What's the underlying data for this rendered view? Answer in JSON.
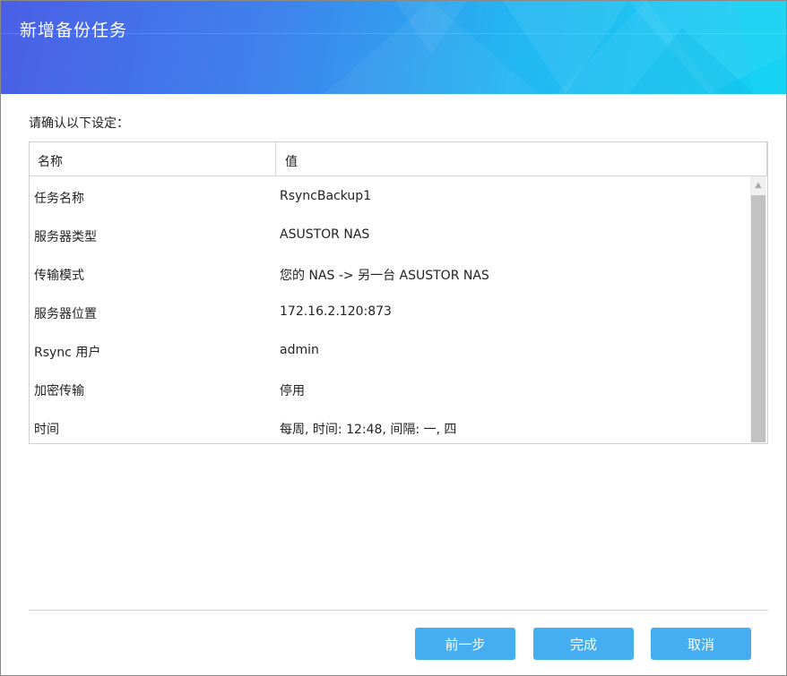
{
  "dialog": {
    "title": "新增备份任务",
    "prompt": "请确认以下设定："
  },
  "table": {
    "headers": {
      "name": "名称",
      "value": "值"
    },
    "rows": [
      {
        "name": "任务名称",
        "value": "RsyncBackup1"
      },
      {
        "name": "服务器类型",
        "value": "ASUSTOR NAS"
      },
      {
        "name": "传输模式",
        "value": "您的 NAS -> 另一台 ASUSTOR NAS"
      },
      {
        "name": "服务器位置",
        "value": "172.16.2.120:873"
      },
      {
        "name": "Rsync 用户",
        "value": "admin"
      },
      {
        "name": "加密传输",
        "value": "停用"
      },
      {
        "name": "时间",
        "value": "每周, 时间: 12:48, 间隔: 一, 四"
      }
    ]
  },
  "buttons": {
    "prev": "前一步",
    "finish": "完成",
    "cancel": "取消"
  },
  "colors": {
    "header_gradient_start": "#4a5fe6",
    "header_gradient_end": "#14d2f3",
    "button": "#45aef0",
    "scroll_thumb": "#c2c2c2"
  },
  "icons": {
    "scroll_up": "triangle-up"
  }
}
